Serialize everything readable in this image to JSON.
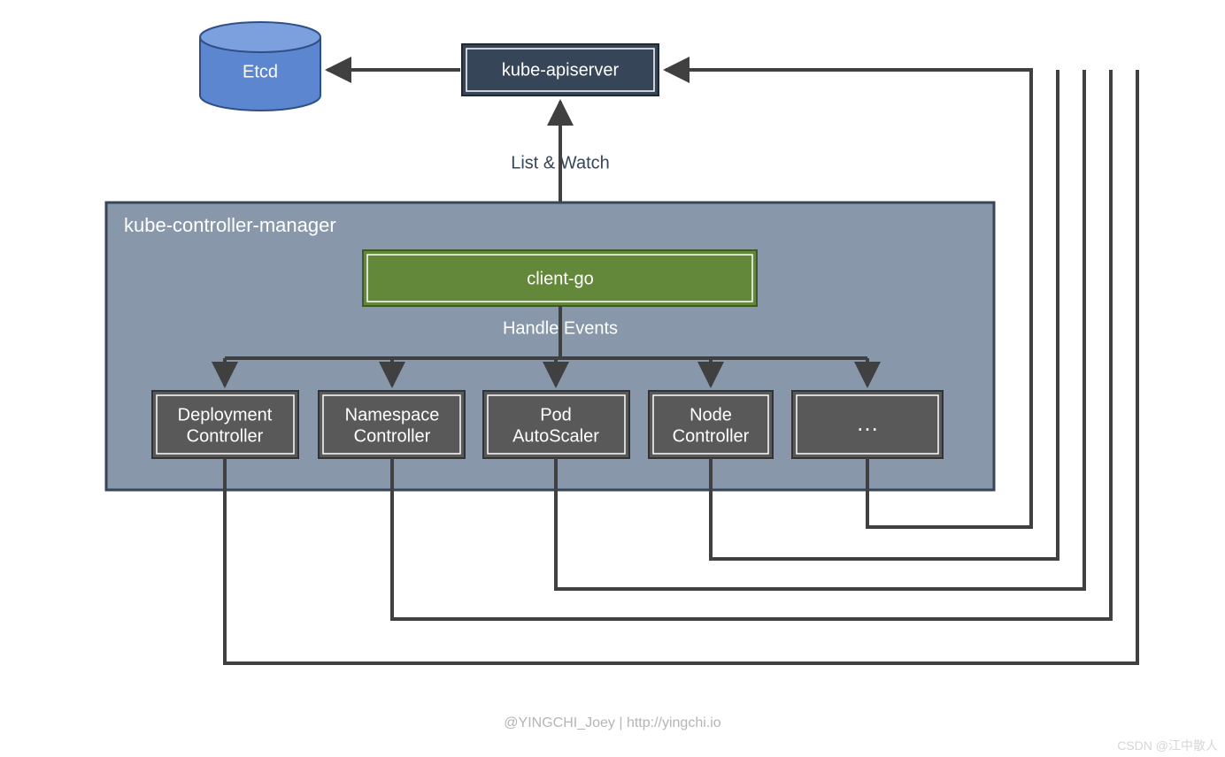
{
  "nodes": {
    "etcd": "Etcd",
    "apiserver": "kube-apiserver",
    "panel_title": "kube-controller-manager",
    "client_go": "client-go",
    "deployment_l1": "Deployment",
    "deployment_l2": "Controller",
    "namespace_l1": "Namespace",
    "namespace_l2": "Controller",
    "pod_l1": "Pod",
    "pod_l2": "AutoScaler",
    "node_l1": "Node",
    "node_l2": "Controller",
    "more": "…"
  },
  "labels": {
    "list_watch": "List & Watch",
    "handle_events": "Handle Events"
  },
  "footer": "@YINGCHI_Joey | http://yingchi.io",
  "watermark": "CSDN @江中散人",
  "colors": {
    "etcd_fill": "#5c86d0",
    "etcd_stroke": "#2f4f87",
    "apiserver_fill": "#374558",
    "panel_fill": "#8897aa",
    "panel_stroke": "#374558",
    "client_go_fill": "#64883a",
    "controller_fill": "#595959",
    "line": "#404040"
  }
}
